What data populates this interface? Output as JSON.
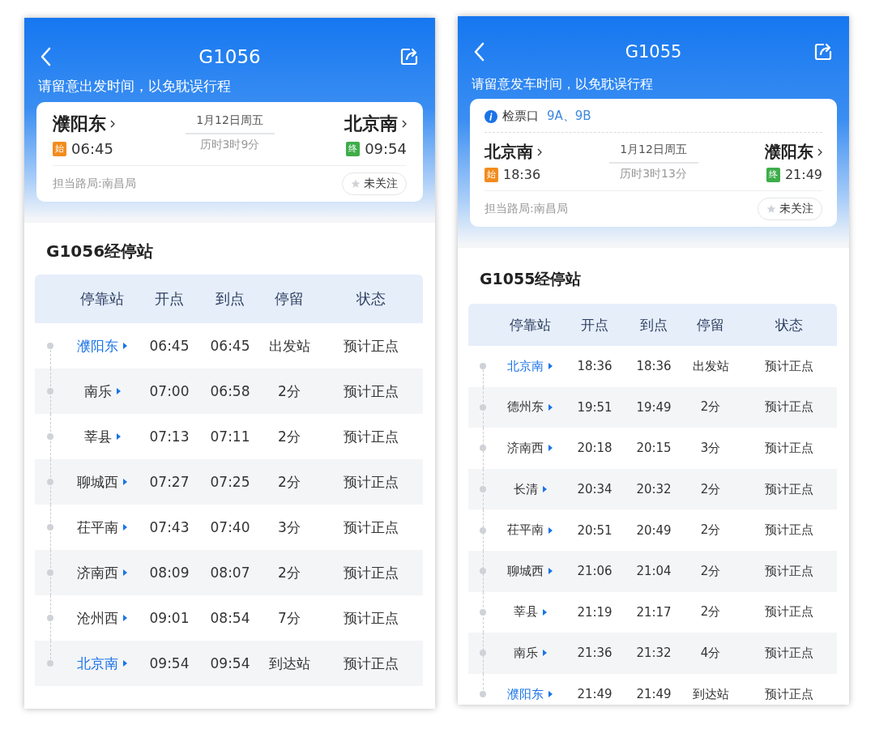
{
  "screens": [
    {
      "title": "G1056",
      "notice": "请留意出发时间，以免耽误行程",
      "card": {
        "from": "濮阳东",
        "from_badge": "始",
        "depart": "06:45",
        "date": "1月12日周五",
        "duration": "历时3时9分",
        "to": "北京南",
        "to_badge": "终",
        "arrive": "09:54",
        "bureau": "担当路局:南昌局",
        "follow": "未关注"
      },
      "stops_title": "G1056经停站",
      "columns": [
        "停靠站",
        "开点",
        "到点",
        "停留",
        "状态"
      ],
      "rows": [
        {
          "station": "濮阳东",
          "endpoint": true,
          "depart": "06:45",
          "arrive": "06:45",
          "stay": "出发站",
          "status": "预计正点"
        },
        {
          "station": "南乐",
          "endpoint": false,
          "depart": "07:00",
          "arrive": "06:58",
          "stay": "2分",
          "status": "预计正点"
        },
        {
          "station": "莘县",
          "endpoint": false,
          "depart": "07:13",
          "arrive": "07:11",
          "stay": "2分",
          "status": "预计正点"
        },
        {
          "station": "聊城西",
          "endpoint": false,
          "depart": "07:27",
          "arrive": "07:25",
          "stay": "2分",
          "status": "预计正点"
        },
        {
          "station": "茌平南",
          "endpoint": false,
          "depart": "07:43",
          "arrive": "07:40",
          "stay": "3分",
          "status": "预计正点"
        },
        {
          "station": "济南西",
          "endpoint": false,
          "depart": "08:09",
          "arrive": "08:07",
          "stay": "2分",
          "status": "预计正点"
        },
        {
          "station": "沧州西",
          "endpoint": false,
          "depart": "09:01",
          "arrive": "08:54",
          "stay": "7分",
          "status": "预计正点"
        },
        {
          "station": "北京南",
          "endpoint": true,
          "depart": "09:54",
          "arrive": "09:54",
          "stay": "到达站",
          "status": "预计正点"
        }
      ]
    },
    {
      "title": "G1055",
      "notice": "请留意发车时间，以免耽误行程",
      "checkin": {
        "label": "检票口",
        "gates": "9A、9B"
      },
      "card": {
        "from": "北京南",
        "from_badge": "始",
        "depart": "18:36",
        "date": "1月12日周五",
        "duration": "历时3时13分",
        "to": "濮阳东",
        "to_badge": "终",
        "arrive": "21:49",
        "bureau": "担当路局:南昌局",
        "follow": "未关注"
      },
      "stops_title": "G1055经停站",
      "columns": [
        "停靠站",
        "开点",
        "到点",
        "停留",
        "状态"
      ],
      "rows": [
        {
          "station": "北京南",
          "endpoint": true,
          "depart": "18:36",
          "arrive": "18:36",
          "stay": "出发站",
          "status": "预计正点"
        },
        {
          "station": "德州东",
          "endpoint": false,
          "depart": "19:51",
          "arrive": "19:49",
          "stay": "2分",
          "status": "预计正点"
        },
        {
          "station": "济南西",
          "endpoint": false,
          "depart": "20:18",
          "arrive": "20:15",
          "stay": "3分",
          "status": "预计正点"
        },
        {
          "station": "长清",
          "endpoint": false,
          "depart": "20:34",
          "arrive": "20:32",
          "stay": "2分",
          "status": "预计正点"
        },
        {
          "station": "茌平南",
          "endpoint": false,
          "depart": "20:51",
          "arrive": "20:49",
          "stay": "2分",
          "status": "预计正点"
        },
        {
          "station": "聊城西",
          "endpoint": false,
          "depart": "21:06",
          "arrive": "21:04",
          "stay": "2分",
          "status": "预计正点"
        },
        {
          "station": "莘县",
          "endpoint": false,
          "depart": "21:19",
          "arrive": "21:17",
          "stay": "2分",
          "status": "预计正点"
        },
        {
          "station": "南乐",
          "endpoint": false,
          "depart": "21:36",
          "arrive": "21:32",
          "stay": "4分",
          "status": "预计正点"
        },
        {
          "station": "濮阳东",
          "endpoint": true,
          "depart": "21:49",
          "arrive": "21:49",
          "stay": "到达站",
          "status": "预计正点"
        }
      ]
    }
  ]
}
